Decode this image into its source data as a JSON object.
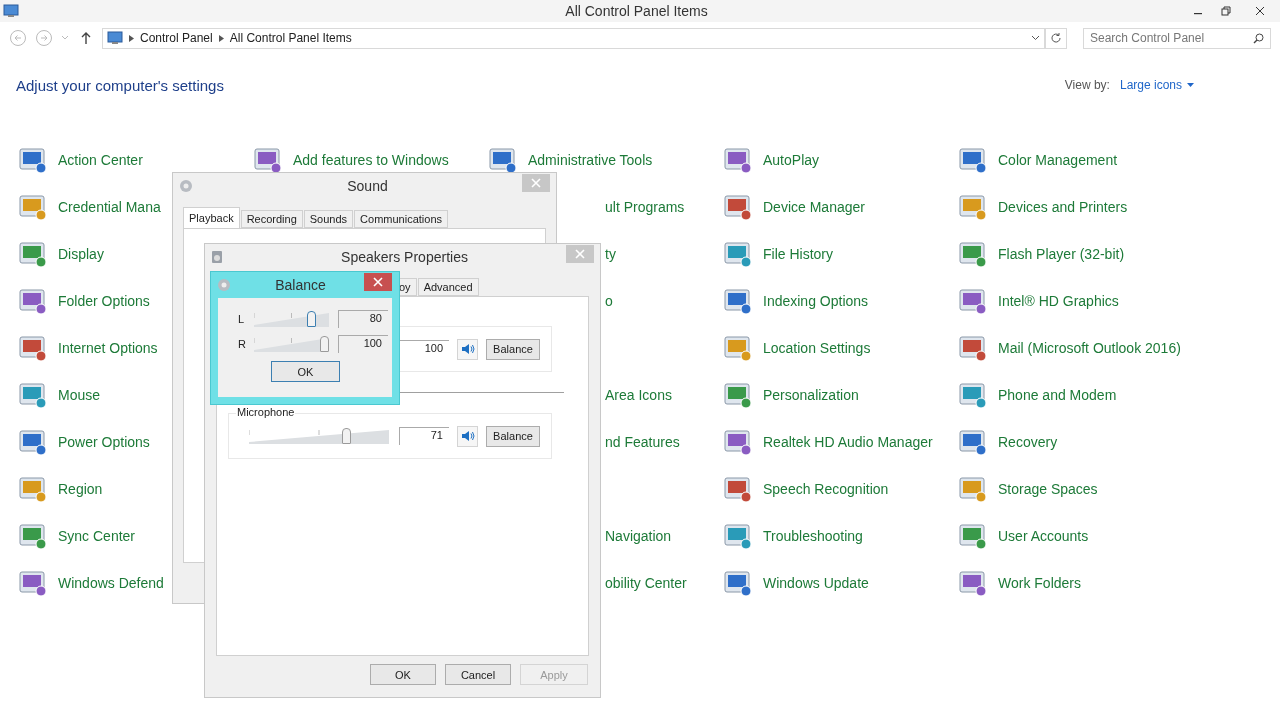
{
  "window": {
    "title": "All Control Panel Items"
  },
  "address": {
    "crumbs": [
      "Control Panel",
      "All Control Panel Items"
    ]
  },
  "search": {
    "placeholder": "Search Control Panel"
  },
  "heading": "Adjust your computer's settings",
  "view_by": {
    "label": "View by:",
    "value": "Large icons"
  },
  "columns": [
    {
      "items": [
        {
          "label": "Action Center",
          "kind": "full"
        },
        {
          "label": "Credential Mana",
          "kind": "full"
        },
        {
          "label": "Display",
          "kind": "full"
        },
        {
          "label": "Folder Options",
          "kind": "full"
        },
        {
          "label": "Internet Options",
          "kind": "full"
        },
        {
          "label": "Mouse",
          "kind": "full"
        },
        {
          "label": "Power Options",
          "kind": "full"
        },
        {
          "label": "Region",
          "kind": "full"
        },
        {
          "label": "Sync Center",
          "kind": "full"
        },
        {
          "label": "Windows Defend",
          "kind": "full"
        }
      ]
    },
    {
      "items": [
        {
          "label": "Add features to Windows",
          "kind": "full"
        }
      ]
    },
    {
      "items": [
        {
          "label": "Administrative Tools",
          "kind": "full"
        },
        {
          "label": "ult Programs",
          "kind": "cut"
        },
        {
          "label": "ty",
          "kind": "cut"
        },
        {
          "label": "o",
          "kind": "cut"
        },
        {
          "kind": "covered"
        },
        {
          "label": "Area Icons",
          "kind": "cut"
        },
        {
          "label": "nd Features",
          "kind": "cut"
        },
        {
          "kind": "covered"
        },
        {
          "label": "Navigation",
          "kind": "cut"
        },
        {
          "label": "obility Center",
          "kind": "cut"
        }
      ]
    },
    {
      "items": [
        {
          "label": "AutoPlay",
          "kind": "full"
        },
        {
          "label": "Device Manager",
          "kind": "full"
        },
        {
          "label": "File History",
          "kind": "full"
        },
        {
          "label": "Indexing Options",
          "kind": "full"
        },
        {
          "label": "Location Settings",
          "kind": "full"
        },
        {
          "label": "Personalization",
          "kind": "full"
        },
        {
          "label": "Realtek HD Audio Manager",
          "kind": "full"
        },
        {
          "label": "Speech Recognition",
          "kind": "full"
        },
        {
          "label": "Troubleshooting",
          "kind": "full"
        },
        {
          "label": "Windows Update",
          "kind": "full"
        }
      ]
    },
    {
      "items": [
        {
          "label": "Color Management",
          "kind": "full"
        },
        {
          "label": "Devices and Printers",
          "kind": "full"
        },
        {
          "label": "Flash Player (32-bit)",
          "kind": "full"
        },
        {
          "label": "Intel® HD Graphics",
          "kind": "full"
        },
        {
          "label": "Mail (Microsoft Outlook 2016)",
          "kind": "full"
        },
        {
          "label": "Phone and Modem",
          "kind": "full"
        },
        {
          "label": "Recovery",
          "kind": "full"
        },
        {
          "label": "Storage Spaces",
          "kind": "full"
        },
        {
          "label": "User Accounts",
          "kind": "full"
        },
        {
          "label": "Work Folders",
          "kind": "full"
        }
      ]
    }
  ],
  "sound_dialog": {
    "title": "Sound",
    "tabs": [
      {
        "label": "Playback",
        "selected": true
      },
      {
        "label": "Recording",
        "selected": false
      },
      {
        "label": "Sounds",
        "selected": false
      },
      {
        "label": "Communications",
        "selected": false
      }
    ]
  },
  "speakers_dialog": {
    "title": "Speakers Properties",
    "tabs": [
      {
        "label": "oy",
        "selected": false
      },
      {
        "label": "Advanced",
        "selected": false
      }
    ],
    "channels": [
      {
        "value": "100",
        "muted": false,
        "button": "Balance"
      },
      {
        "name": "Microphone",
        "level": 0.71,
        "value": "71",
        "muted": false,
        "button": "Balance"
      }
    ],
    "buttons": [
      {
        "label": "OK",
        "disabled": false
      },
      {
        "label": "Cancel",
        "disabled": false
      },
      {
        "label": "Apply",
        "disabled": true
      }
    ]
  },
  "balance_dialog": {
    "title": "Balance",
    "channels": [
      {
        "label": "L",
        "level": 0.8,
        "value": "80"
      },
      {
        "label": "R",
        "level": 1,
        "value": "100"
      }
    ],
    "button": "OK"
  }
}
